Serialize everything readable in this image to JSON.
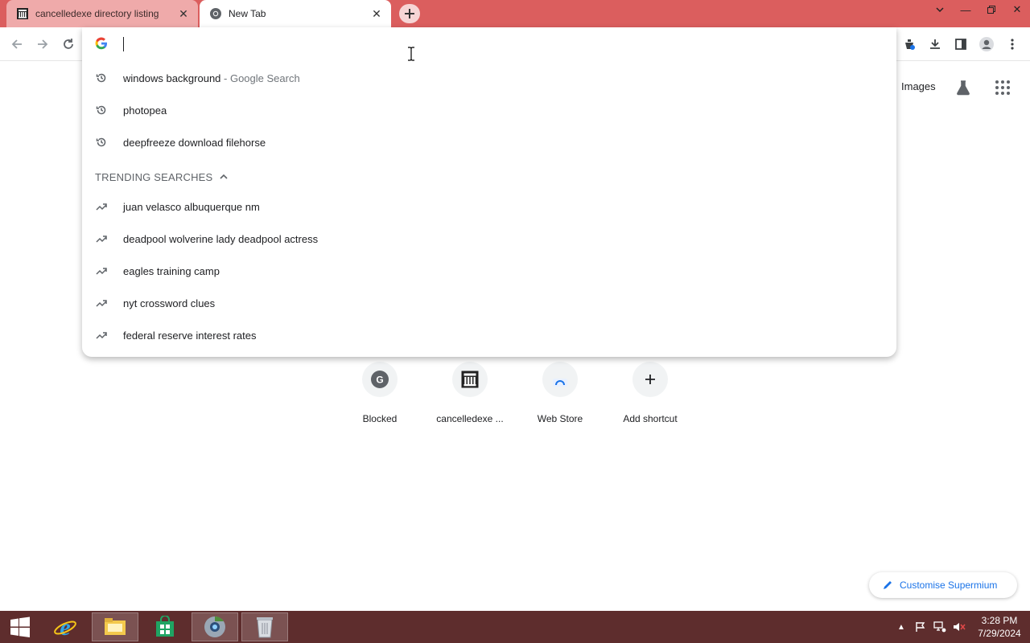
{
  "tabs": [
    {
      "title": "cancelledexe directory listing",
      "icon": "library-icon",
      "active": false
    },
    {
      "title": "New Tab",
      "icon": "chromium-icon",
      "active": true
    }
  ],
  "omnibox": {
    "input_value": "",
    "placeholder": "",
    "history": [
      {
        "text": "windows background",
        "suffix": " - Google Search"
      },
      {
        "text": "photopea",
        "suffix": ""
      },
      {
        "text": "deepfreeze download filehorse",
        "suffix": ""
      }
    ],
    "trending_header": "TRENDING SEARCHES",
    "trending": [
      "juan velasco albuquerque nm",
      "deadpool wolverine lady deadpool actress",
      "eagles training camp",
      "nyt crossword clues",
      "federal reserve interest rates"
    ]
  },
  "ntp": {
    "images_link": "Images",
    "shortcuts": [
      {
        "label": "Blocked",
        "icon": "g-letter-icon",
        "letter": "G"
      },
      {
        "label": "cancelledexe ...",
        "icon": "library-icon"
      },
      {
        "label": "Web Store",
        "icon": "web-store-icon"
      },
      {
        "label": "Add shortcut",
        "icon": "plus-icon"
      }
    ],
    "customise_label": "Customise Supermium"
  },
  "taskbar": {
    "time": "3:28 PM",
    "date": "7/29/2024"
  },
  "colors": {
    "titlebar": "#db5e5e",
    "taskbar": "#5e2d2d",
    "accent": "#1a73e8"
  }
}
